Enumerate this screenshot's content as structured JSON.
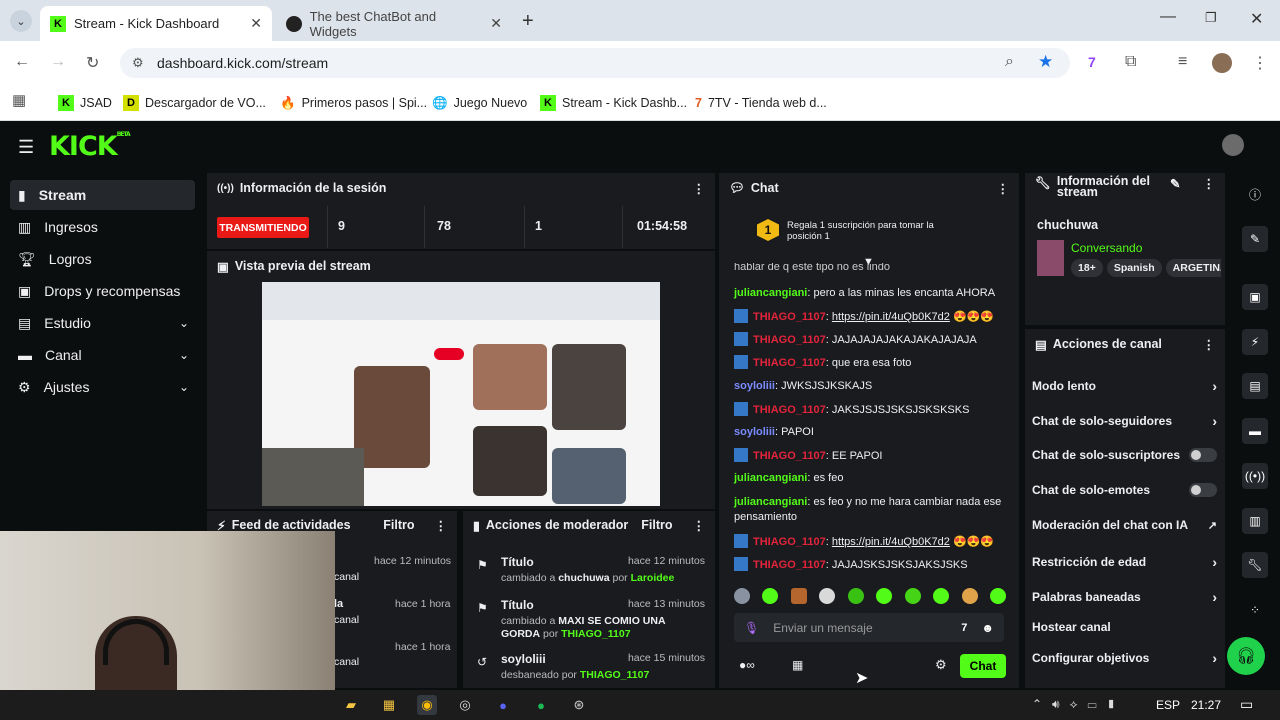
{
  "browser": {
    "tabs": [
      {
        "title": "Stream - Kick Dashboard"
      },
      {
        "title": "The best ChatBot and Widgets"
      }
    ],
    "url": "dashboard.kick.com/stream",
    "bookmarks": [
      "JSAD",
      "Descargador de VO...",
      "Primeros pasos | Spi...",
      "Juego Nuevo",
      "Stream - Kick Dashb...",
      "7TV - Tienda web d..."
    ]
  },
  "kick": {
    "logo": "KICK",
    "logo_beta": "BETA",
    "nav": [
      {
        "label": "Stream"
      },
      {
        "label": "Ingresos"
      },
      {
        "label": "Logros"
      },
      {
        "label": "Drops y recompensas"
      },
      {
        "label": "Estudio"
      },
      {
        "label": "Canal"
      },
      {
        "label": "Ajustes"
      }
    ],
    "session": {
      "title": "Información de la sesión",
      "status": "TRANSMITIENDO",
      "stats": [
        "9",
        "78",
        "1",
        "01:54:58"
      ]
    },
    "preview": {
      "title": "Vista previa del stream"
    },
    "feed": {
      "title": "Feed de actividades",
      "filter": "Filtro",
      "items": [
        {
          "time": "hace 12 minutos",
          "sub": "canal"
        },
        {
          "label": "la",
          "time": "hace 1 hora",
          "sub": "canal"
        },
        {
          "time": "hace 1 hora",
          "sub": "canal"
        }
      ]
    },
    "mod": {
      "title": "Acciones de moderador",
      "filter": "Filtro",
      "rows": [
        {
          "title": "Título",
          "time": "hace 12 minutos",
          "pre": "cambiado a",
          "val": "chuchuwa",
          "by_word": "por",
          "by": "Laroidee"
        },
        {
          "title": "Título",
          "time": "hace 13 minutos",
          "pre": "cambiado a",
          "val": "MAXI SE COMIO UNA GORDA",
          "by_word": "por",
          "by": "THIAGO_1107"
        },
        {
          "title": "soyloliii",
          "time": "hace 15 minutos",
          "pre": "desbaneado",
          "by_word": "por",
          "by": "THIAGO_1107"
        }
      ]
    },
    "chat": {
      "title": "Chat",
      "gift_rank": "1",
      "gift_text": "Regala 1 suscripción para tomar la posición 1",
      "cut_line": "hablar de q este tipo no es lindo",
      "messages": [
        {
          "user": "juliancangiani",
          "color": "g",
          "text": "pero a las minas les encanta AHORA"
        },
        {
          "user": "THIAGO_1107",
          "color": "r",
          "badge": true,
          "text": "https://pin.it/4uQb0K7d2",
          "link": true,
          "emoji": "😍😍😍"
        },
        {
          "user": "THIAGO_1107",
          "color": "r",
          "badge": true,
          "text": "JAJAJAJAJAKAJAKAJAJAJA"
        },
        {
          "user": "THIAGO_1107",
          "color": "r",
          "badge": true,
          "text": "que era esa foto"
        },
        {
          "user": "soyloliii",
          "color": "b",
          "text": "JWKSJSJKSKAJS"
        },
        {
          "user": "THIAGO_1107",
          "color": "r",
          "badge": true,
          "text": "JAKSJSJSJSKSJSKSKSKS"
        },
        {
          "user": "soyloliii",
          "color": "b",
          "text": "PAPOI"
        },
        {
          "user": "THIAGO_1107",
          "color": "r",
          "badge": true,
          "text": "EE PAPOI"
        },
        {
          "user": "juliancangiani",
          "color": "g",
          "text": "es feo"
        },
        {
          "user": "juliancangiani",
          "color": "g",
          "text": "es feo y no me hara cambiar nada ese pensamiento"
        },
        {
          "user": "THIAGO_1107",
          "color": "r",
          "badge": true,
          "text": "https://pin.it/4uQb0K7d2",
          "link": true,
          "emoji": "😍😍😍"
        },
        {
          "user": "THIAGO_1107",
          "color": "r",
          "badge": true,
          "text": "JAJAJSKSJSKSJAKSJSKS"
        }
      ],
      "placeholder": "Enviar un mensaje",
      "send": "Chat"
    },
    "stream_info": {
      "title": "Información del stream",
      "channel": "chuchuwa",
      "category": "Conversando",
      "tags": [
        "18+",
        "Spanish",
        "ARGETIN..."
      ]
    },
    "channel_actions": {
      "title": "Acciones de canal",
      "items": [
        {
          "label": "Modo lento",
          "ctrl": "chev"
        },
        {
          "label": "Chat de solo-seguidores",
          "ctrl": "chev"
        },
        {
          "label": "Chat de solo-suscriptores",
          "ctrl": "toggle"
        },
        {
          "label": "Chat de solo-emotes",
          "ctrl": "toggle"
        },
        {
          "label": "Moderación del chat con IA",
          "ctrl": "ext"
        },
        {
          "label": "Restricción de edad",
          "ctrl": "chev"
        },
        {
          "label": "Palabras baneadas",
          "ctrl": "chev"
        },
        {
          "label": "Hostear canal",
          "ctrl": "none"
        },
        {
          "label": "Configurar objetivos",
          "ctrl": "chev"
        }
      ]
    }
  },
  "taskbar": {
    "lang": "ESP",
    "time": "21:27"
  },
  "colors": {
    "kick_green": "#53fc18",
    "live_red": "#e91916",
    "panel": "#191b1f"
  }
}
